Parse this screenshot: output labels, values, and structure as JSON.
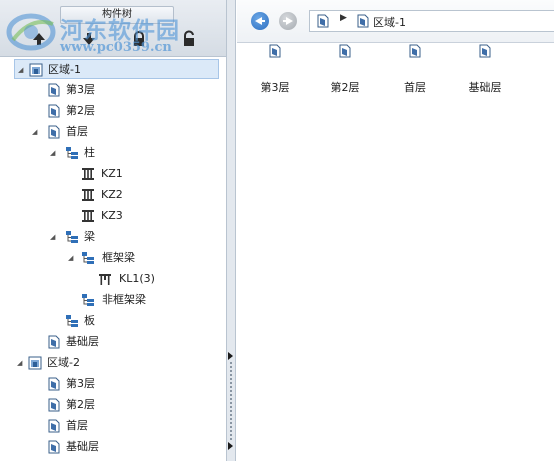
{
  "left_panel": {
    "title": "构件树",
    "toolbar": [
      {
        "name": "up-arrow-icon"
      },
      {
        "name": "down-arrow-icon"
      },
      {
        "name": "lock-icon"
      },
      {
        "name": "unlock-icon"
      }
    ]
  },
  "watermark": {
    "site_name": "河东软件园",
    "url": "www.pc0359.cn"
  },
  "tree": [
    {
      "label": "区域-1",
      "icon": "region-icon",
      "expanded": true,
      "selected": true
    },
    {
      "label": "第3层",
      "icon": "floor-icon"
    },
    {
      "label": "第2层",
      "icon": "floor-icon"
    },
    {
      "label": "首层",
      "icon": "floor-icon",
      "expanded": true
    },
    {
      "label": "柱",
      "icon": "category-icon",
      "expanded": true
    },
    {
      "label": "KZ1",
      "icon": "column-icon"
    },
    {
      "label": "KZ2",
      "icon": "column-icon"
    },
    {
      "label": "KZ3",
      "icon": "column-icon"
    },
    {
      "label": "梁",
      "icon": "category-icon",
      "expanded": true
    },
    {
      "label": "框架梁",
      "icon": "category-icon",
      "expanded": true
    },
    {
      "label": "KL1(3)",
      "icon": "beam-icon"
    },
    {
      "label": "非框架梁",
      "icon": "category-icon"
    },
    {
      "label": "板",
      "icon": "category-icon"
    },
    {
      "label": "基础层",
      "icon": "floor-icon"
    },
    {
      "label": "区域-2",
      "icon": "region-icon",
      "expanded": true
    },
    {
      "label": "第3层",
      "icon": "floor-icon"
    },
    {
      "label": "第2层",
      "icon": "floor-icon"
    },
    {
      "label": "首层",
      "icon": "floor-icon"
    },
    {
      "label": "基础层",
      "icon": "floor-icon"
    }
  ],
  "navigation": {
    "back_icon": "back-arrow-icon",
    "forward_icon": "forward-arrow-icon",
    "path": "区域-1"
  },
  "content_items": [
    {
      "label": "第3层",
      "icon": "floor-icon"
    },
    {
      "label": "第2层",
      "icon": "floor-icon"
    },
    {
      "label": "首层",
      "icon": "floor-icon"
    },
    {
      "label": "基础层",
      "icon": "floor-icon"
    }
  ],
  "colors": {
    "selection": "#dbe9f8",
    "accent_blue": "#2e6fc0",
    "panel_border": "#b9c4d0"
  }
}
